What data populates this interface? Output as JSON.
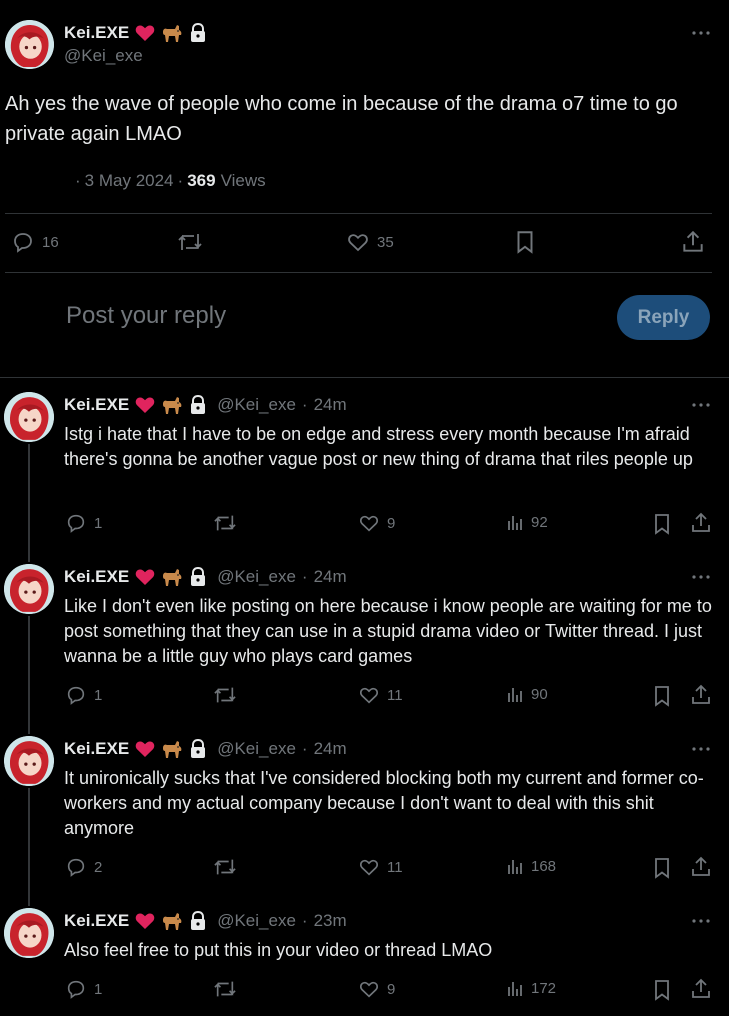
{
  "main_post": {
    "author_name": "Kei.EXE",
    "author_handle": "@Kei_exe",
    "text": "Ah yes the wave of people who come in because of the drama o7 time to go private again LMAO",
    "date": "3 May 2024",
    "views_count": "369",
    "views_label": "Views",
    "replies": "16",
    "likes": "35"
  },
  "reply_box": {
    "placeholder": "Post your reply",
    "button_label": "Reply"
  },
  "thread": [
    {
      "author_name": "Kei.EXE",
      "author_handle": "@Kei_exe",
      "time": "24m",
      "text": "Istg i hate that I have to be on edge and stress every month because I'm afraid there's gonna be another vague post or new thing of drama that riles people up",
      "replies": "1",
      "likes": "9",
      "views": "92"
    },
    {
      "author_name": "Kei.EXE",
      "author_handle": "@Kei_exe",
      "time": "24m",
      "text": "Like I don't even like posting on here because i know people are waiting for me to post something that they can use in a stupid drama video or Twitter thread. I just wanna be a little guy who plays card games",
      "replies": "1",
      "likes": "11",
      "views": "90"
    },
    {
      "author_name": "Kei.EXE",
      "author_handle": "@Kei_exe",
      "time": "24m",
      "text": "It unironically sucks that I've considered blocking both my current and former co-workers and my actual company because I don't want to deal with this shit anymore",
      "replies": "2",
      "likes": "11",
      "views": "168"
    },
    {
      "author_name": "Kei.EXE",
      "author_handle": "@Kei_exe",
      "time": "23m",
      "text": "Also feel free to put this in your video or thread LMAO",
      "replies": "1",
      "likes": "9",
      "views": "172"
    }
  ],
  "icons": [
    "avatar",
    "red-heart-icon",
    "dog-icon",
    "lock-icon",
    "more-icon",
    "reply-icon",
    "repost-icon",
    "like-icon",
    "bookmark-icon",
    "share-icon",
    "views-icon"
  ],
  "colors": {
    "background": "#000000",
    "text": "#e7e9ea",
    "muted": "#71767b",
    "divider": "#2f3336",
    "reply_button": "#1d4d7a",
    "heart": "#e0245e"
  }
}
